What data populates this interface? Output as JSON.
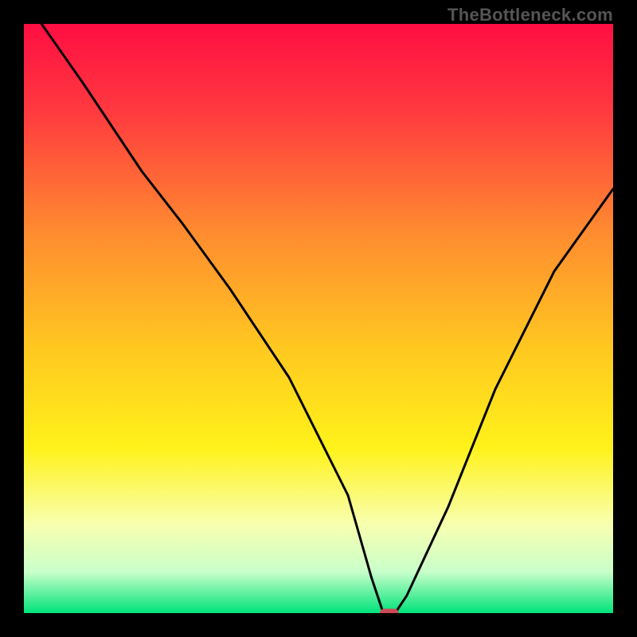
{
  "watermark": "TheBottleneck.com",
  "chart_data": {
    "type": "line",
    "title": "",
    "xlabel": "",
    "ylabel": "",
    "xlim": [
      0,
      100
    ],
    "ylim": [
      0,
      100
    ],
    "grid": false,
    "background": "vertical-rainbow-gradient",
    "gradient_colors": [
      {
        "stop": 0.0,
        "hex": "#ff0e42"
      },
      {
        "stop": 0.15,
        "hex": "#ff3a3f"
      },
      {
        "stop": 0.35,
        "hex": "#ff8a30"
      },
      {
        "stop": 0.55,
        "hex": "#ffc820"
      },
      {
        "stop": 0.72,
        "hex": "#fff21a"
      },
      {
        "stop": 0.85,
        "hex": "#f8ffb0"
      },
      {
        "stop": 0.93,
        "hex": "#c8ffca"
      },
      {
        "stop": 1.0,
        "hex": "#00e37a"
      }
    ],
    "series": [
      {
        "name": "bottleneck-curve",
        "stroke": "#000000",
        "x": [
          3,
          10,
          20,
          27,
          35,
          45,
          55,
          59,
          61,
          63,
          65,
          72,
          80,
          90,
          100
        ],
        "y": [
          100,
          90,
          75,
          66,
          55,
          40,
          20,
          6,
          0,
          0,
          3,
          18,
          38,
          58,
          72
        ]
      }
    ],
    "marker": {
      "shape": "rounded-pill",
      "color": "#cc4b56",
      "x": 62,
      "y": 0,
      "width_pct": 3.2,
      "height_pct": 1.5
    }
  }
}
